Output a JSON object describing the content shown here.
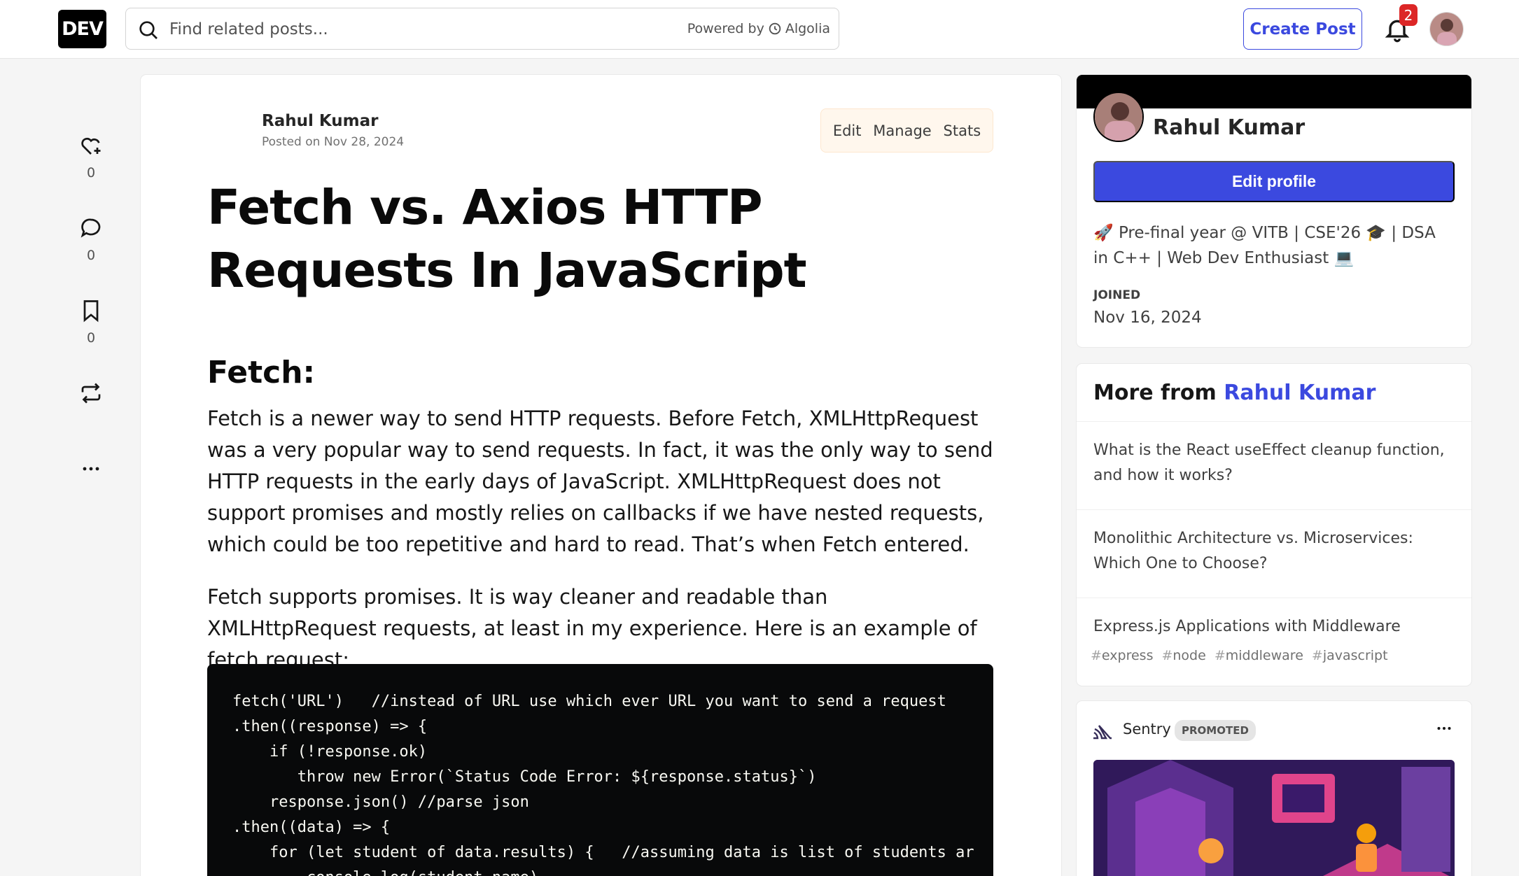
{
  "header": {
    "logo_text": "DEV",
    "search_placeholder": "Find related posts...",
    "powered_by": "Powered by",
    "powered_brand": "Algolia",
    "create_post_label": "Create Post",
    "notification_count": "2"
  },
  "reactions": {
    "likes": "0",
    "comments": "0",
    "bookmarks": "0"
  },
  "article": {
    "author_name": "Rahul Kumar",
    "posted_on": "Posted on Nov 28, 2024",
    "actions": [
      "Edit",
      "Manage",
      "Stats"
    ],
    "title": "Fetch vs. Axios HTTP Requests In JavaScript",
    "section_heading": "Fetch:",
    "paragraph_1": "Fetch is a newer way to send HTTP requests. Before Fetch, XMLHttpRequest was a very popular way to send requests. In fact, it was the only way to send HTTP requests in the early days of JavaScript. XMLHttpRequest does not support promises and mostly relies on callbacks if we have nested requests, which could be too repetitive and hard to read. That’s when Fetch entered.",
    "paragraph_2": "Fetch supports promises. It is way cleaner and readable than XMLHttpRequest requests, at least in my experience. Here is an example of fetch request:",
    "code": "fetch('URL')   //instead of URL use which ever URL you want to send a request\n.then((response) => {\n    if (!response.ok)\n       throw new Error(`Status Code Error: ${response.status}`)\n    response.json() //parse json\n.then((data) => {\n    for (let student of data.results) {   //assuming data is list of students ar\n        console.log(student.name)"
  },
  "profile": {
    "name": "Rahul Kumar",
    "edit_profile_label": "Edit profile",
    "bio": "🚀 Pre-final year @ VITB | CSE'26 🎓 | DSA in C++ | Web Dev Enthusiast 💻",
    "joined_label": "JOINED",
    "joined_date": "Nov 16, 2024"
  },
  "more_from": {
    "heading_prefix": "More from",
    "heading_author": "Rahul Kumar",
    "items": [
      "What is the React useEffect cleanup function, and how it works?",
      "Monolithic Architecture vs. Microservices: Which One to Choose?",
      "Express.js Applications with Middleware"
    ],
    "tags": [
      "express",
      "node",
      "middleware",
      "javascript"
    ]
  },
  "promo": {
    "brand": "Sentry",
    "label": "PROMOTED"
  },
  "colors": {
    "accent": "#3b49df",
    "badge": "#dc2626",
    "code_bg": "#08090a"
  }
}
